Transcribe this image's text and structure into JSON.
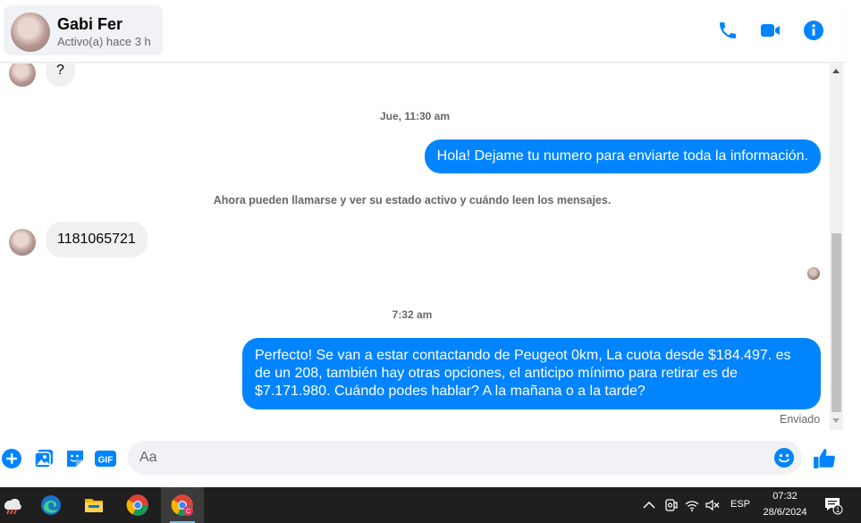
{
  "header": {
    "contact_name": "Gabi Fer",
    "contact_status": "Activo(a) hace 3 h",
    "icons": [
      "phone-icon",
      "video-call-icon",
      "info-icon"
    ],
    "accent_color": "#0084ff"
  },
  "chat": {
    "messages": [
      {
        "type": "incoming",
        "text": "?"
      },
      {
        "type": "timestamp",
        "text": "Jue, 11:30 am"
      },
      {
        "type": "outgoing",
        "text": "Hola! Dejame tu numero  para enviarte toda la información."
      },
      {
        "type": "notice",
        "text": "Ahora pueden llamarse y ver su estado activo y cuándo leen los mensajes."
      },
      {
        "type": "incoming",
        "text": "1181065721"
      },
      {
        "type": "timestamp",
        "text": "7:32 am"
      },
      {
        "type": "outgoing",
        "lines": [
          "Perfecto!  Se van a estar contactando de Peugeot 0km, La cuota desde $184.497. es",
          "de un 208, también hay otras opciones, el anticipo mínimo para retirar es de",
          "$7.171.980. Cuándo podes hablar? A la mañana o a la tarde?"
        ]
      }
    ],
    "delivery_status": "Enviado",
    "incoming_bubble_color": "#f0f0f0",
    "outgoing_bubble_color": "#0084ff"
  },
  "composer": {
    "placeholder": "Aa",
    "icons": [
      "add-icon",
      "gallery-icon",
      "sticker-icon",
      "gif-icon",
      "emoji-icon",
      "like-icon"
    ]
  },
  "taskbar": {
    "apps": [
      "weather-icon",
      "edge-icon",
      "file-explorer-icon",
      "chrome-icon",
      "chrome-profile-icon"
    ],
    "language": "ESP",
    "time": "07:32",
    "date": "28/6/2024",
    "notification_count": "1"
  }
}
